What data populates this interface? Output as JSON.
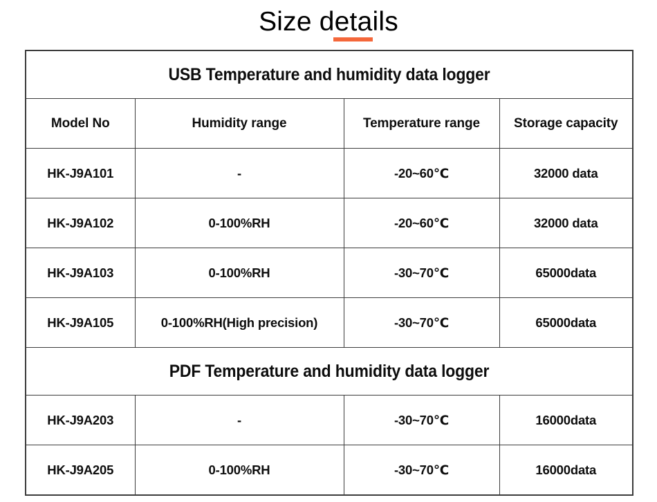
{
  "page": {
    "title": "Size details",
    "accent_color": "#F4673A",
    "border_color": "#3b3b3b",
    "text_color": "#0d0d0d",
    "background": "#ffffff"
  },
  "table": {
    "columns": [
      {
        "key": "model",
        "label": "Model No"
      },
      {
        "key": "humidity",
        "label": "Humidity range"
      },
      {
        "key": "temperature",
        "label": "Temperature range"
      },
      {
        "key": "storage",
        "label": "Storage capacity"
      }
    ],
    "sections": [
      {
        "banner": "USB Temperature and humidity data logger",
        "rows": [
          {
            "model": "HK-J9A101",
            "humidity": "-",
            "temperature": "-20~60℃",
            "storage": "32000 data"
          },
          {
            "model": "HK-J9A102",
            "humidity": "0-100%RH",
            "temperature": "-20~60℃",
            "storage": "32000 data"
          },
          {
            "model": "HK-J9A103",
            "humidity": "0-100%RH",
            "temperature": "-30~70℃",
            "storage": "65000data"
          },
          {
            "model": "HK-J9A105",
            "humidity": "0-100%RH(High precision)",
            "temperature": "-30~70℃",
            "storage": "65000data"
          }
        ]
      },
      {
        "banner": "PDF Temperature and humidity data logger",
        "rows": [
          {
            "model": "HK-J9A203",
            "humidity": "-",
            "temperature": "-30~70℃",
            "storage": "16000data"
          },
          {
            "model": "HK-J9A205",
            "humidity": "0-100%RH",
            "temperature": "-30~70℃",
            "storage": "16000data"
          }
        ]
      }
    ]
  }
}
